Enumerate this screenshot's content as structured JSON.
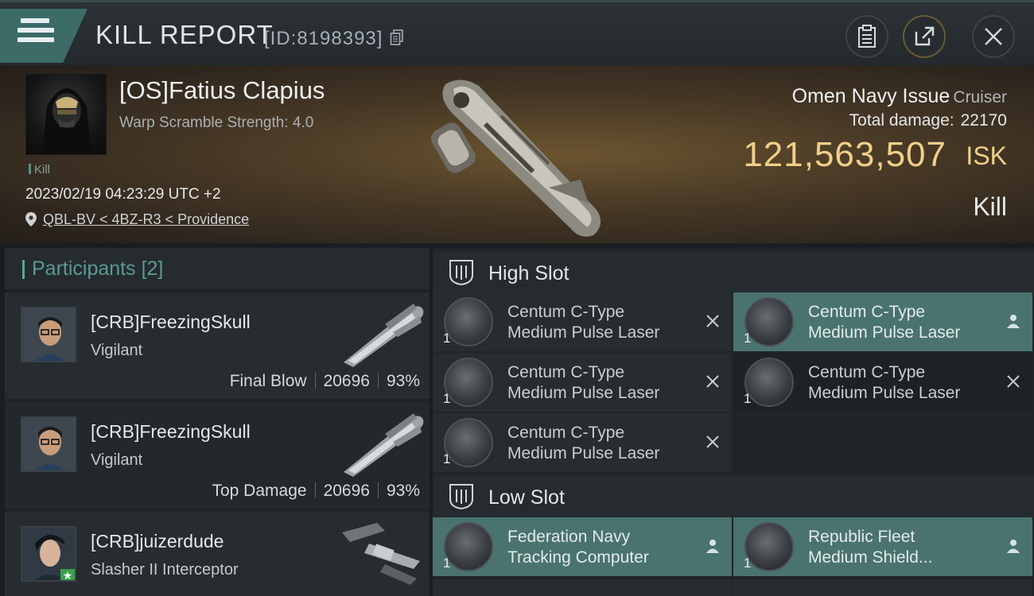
{
  "header": {
    "title": "KILL REPORT",
    "report_id": "[ID:8198393]",
    "menu_icon": "hamburger-icon",
    "buttons": [
      {
        "name": "clipboard-icon"
      },
      {
        "name": "share-icon"
      },
      {
        "name": "close-icon"
      }
    ]
  },
  "victim": {
    "name": "[OS]Fatius Clapius",
    "warp_scramble": "Warp Scramble Strength: 4.0",
    "kill_tag": "Kill",
    "timestamp": "2023/02/19 04:23:29 UTC +2",
    "location": "QBL-BV < 4BZ-R3 < Providence",
    "ship_name": "Omen Navy Issue",
    "ship_class": "Cruiser",
    "total_damage_label": "Total damage:",
    "total_damage": "22170",
    "isk_value": "121,563,507",
    "isk_unit": "ISK",
    "result": "Kill"
  },
  "participants": {
    "title": "Participants",
    "count": "[2]",
    "items": [
      {
        "name": "[CRB]FreezingSkull",
        "ship": "Vigilant",
        "label": "Final Blow",
        "damage": "20696",
        "percent": "93%"
      },
      {
        "name": "[CRB]FreezingSkull",
        "ship": "Vigilant",
        "label": "Top Damage",
        "damage": "20696",
        "percent": "93%"
      },
      {
        "name": "[CRB]juizerdude",
        "ship": "Slasher II Interceptor"
      }
    ]
  },
  "fitting": {
    "high_slot": {
      "title": "High Slot",
      "modules": [
        {
          "line1": "Centum C-Type",
          "line2": "Medium Pulse Laser",
          "qty": "1",
          "status": "destroyed",
          "highlight": false
        },
        {
          "line1": "Centum C-Type",
          "line2": "Medium Pulse Laser",
          "qty": "1",
          "status": "dropped",
          "highlight": true
        },
        {
          "line1": "Centum C-Type",
          "line2": "Medium Pulse Laser",
          "qty": "1",
          "status": "destroyed",
          "highlight": false
        },
        {
          "line1": "Centum C-Type",
          "line2": "Medium Pulse Laser",
          "qty": "1",
          "status": "destroyed",
          "highlight": false
        },
        {
          "line1": "Centum C-Type",
          "line2": "Medium Pulse Laser",
          "qty": "1",
          "status": "destroyed",
          "highlight": false
        }
      ]
    },
    "low_slot": {
      "title": "Low Slot",
      "modules": [
        {
          "line1": "Federation Navy",
          "line2": "Tracking Computer",
          "qty": "1",
          "status": "dropped",
          "highlight": true
        },
        {
          "line1": "Republic Fleet",
          "line2": "Medium Shield...",
          "qty": "1",
          "status": "dropped",
          "highlight": true
        }
      ]
    }
  },
  "colors": {
    "accent_teal": "#5fa59a",
    "isk_gold": "#f0cf8a",
    "highlight_module": "#4a7370"
  }
}
